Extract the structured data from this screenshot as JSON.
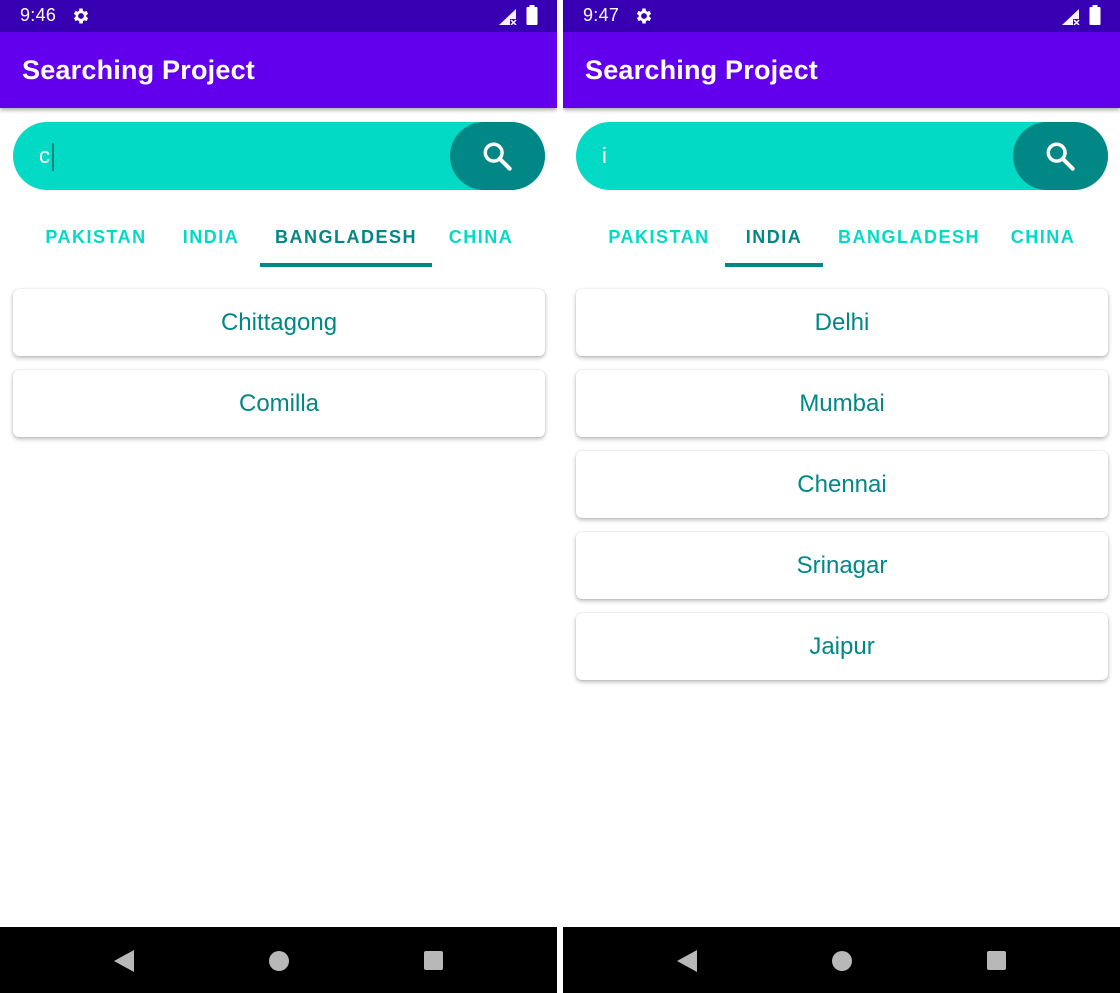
{
  "colors": {
    "status_bar": "#3700b3",
    "app_bar": "#6200ee",
    "search_bg": "#03dac5",
    "accent_dark": "#018786",
    "tab_inactive": "#03dac5"
  },
  "icons": {
    "status": [
      "gear-icon",
      "signal-icon",
      "battery-icon"
    ],
    "search": "search-icon",
    "nav": [
      "back-icon",
      "home-icon",
      "recents-icon"
    ]
  },
  "screens": [
    {
      "status": {
        "time": "9:46"
      },
      "app_bar": {
        "title": "Searching Project"
      },
      "search": {
        "value": "c"
      },
      "tabs": [
        {
          "label": "PAKISTAN",
          "selected": false
        },
        {
          "label": "INDIA",
          "selected": false
        },
        {
          "label": "BANGLADESH",
          "selected": true
        },
        {
          "label": "CHINA",
          "selected": false
        }
      ],
      "results": [
        "Chittagong",
        "Comilla"
      ]
    },
    {
      "status": {
        "time": "9:47"
      },
      "app_bar": {
        "title": "Searching Project"
      },
      "search": {
        "value": "i"
      },
      "tabs": [
        {
          "label": "PAKISTAN",
          "selected": false
        },
        {
          "label": "INDIA",
          "selected": true
        },
        {
          "label": "BANGLADESH",
          "selected": false
        },
        {
          "label": "CHINA",
          "selected": false
        }
      ],
      "results": [
        "Delhi",
        "Mumbai",
        "Chennai",
        "Srinagar",
        "Jaipur"
      ]
    }
  ]
}
